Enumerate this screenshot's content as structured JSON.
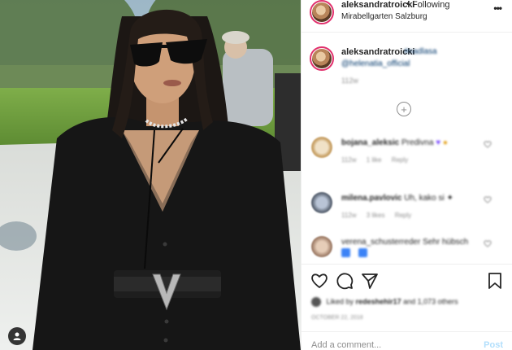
{
  "header": {
    "username": "aleksandratroicki",
    "separator": "•",
    "follow_status": "Following",
    "location": "Mirabellgarten Salzburg",
    "more_glyph": "•••"
  },
  "caption": {
    "username": "aleksandratroicki",
    "line1": "#nadlasa",
    "line2": "@helenatia_official",
    "time": "112w"
  },
  "load_more_glyph": "+",
  "comments": [
    {
      "username": "bojana_aleksic",
      "text": "Predivna",
      "age": "112w",
      "likes": "1 like",
      "reply": "Reply"
    },
    {
      "username": "milena.pavlovic",
      "text": "Uh, kako si",
      "age": "112w",
      "likes": "3 likes",
      "reply": "Reply"
    },
    {
      "username": "verena_schusterreder",
      "text": "Sehr hübsch",
      "age": "",
      "likes": "",
      "reply": ""
    }
  ],
  "likes": {
    "prefix": "Liked by",
    "user": "redeshehir17",
    "suffix": "and 1,073 others"
  },
  "date": "OCTOBER 22, 2018",
  "comment_box": {
    "placeholder": "Add a comment...",
    "post_label": "Post"
  },
  "colors": {
    "link_blue": "#00376b",
    "post_disabled": "#b2dffc",
    "story_ring": "#e1306c",
    "muted": "#8e8e8e"
  },
  "icons": [
    "more-icon",
    "load-more-icon",
    "heart-icon",
    "comment-icon",
    "share-icon",
    "bookmark-icon",
    "user-tag-icon"
  ]
}
